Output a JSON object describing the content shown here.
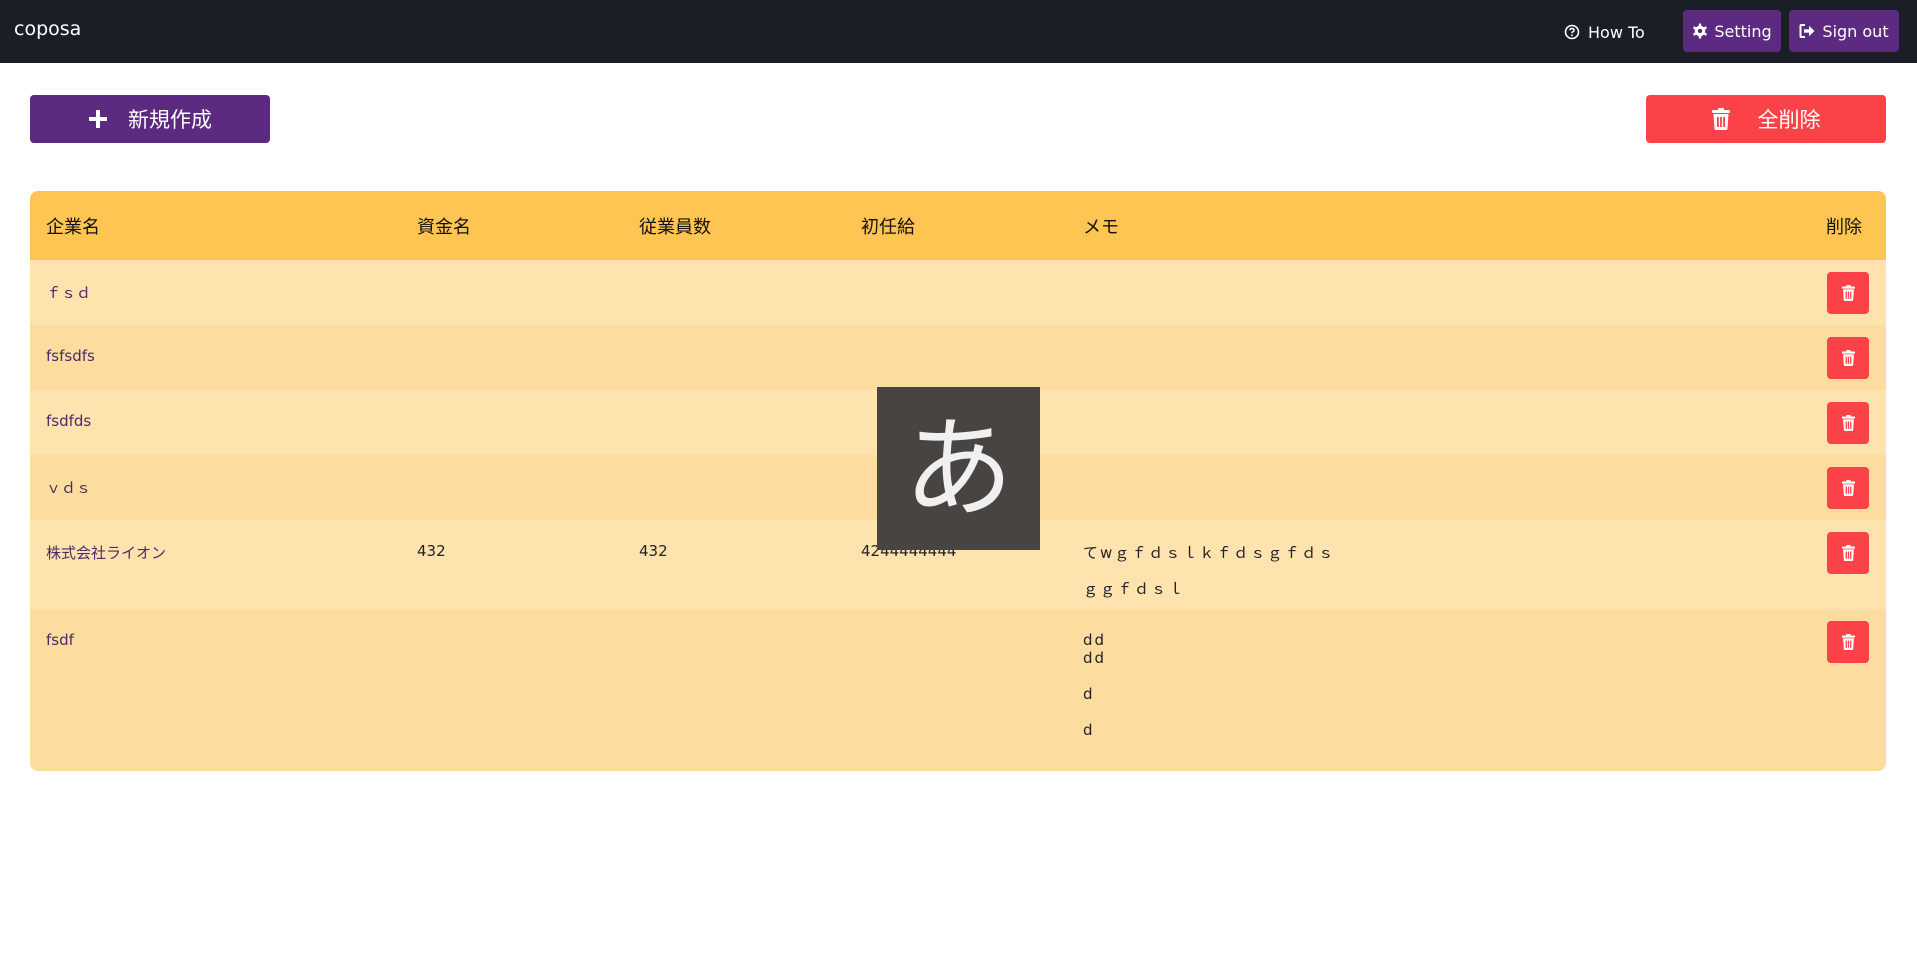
{
  "navbar": {
    "brand": "coposa",
    "howto_label": "How To",
    "setting_label": "Setting",
    "signout_label": "Sign out"
  },
  "actions": {
    "new_label": "新規作成",
    "delete_all_label": "全削除"
  },
  "table": {
    "headers": {
      "company": "企業名",
      "capital": "資金名",
      "employees": "従業員数",
      "salary": "初任給",
      "memo": "メモ",
      "delete": "削除"
    },
    "rows": [
      {
        "company": "ｆｓｄ",
        "capital": "",
        "employees": "",
        "salary": "",
        "memo": []
      },
      {
        "company": "fsfsdfs",
        "capital": "",
        "employees": "",
        "salary": "",
        "memo": []
      },
      {
        "company": "fsdfds",
        "capital": "",
        "employees": "",
        "salary": "",
        "memo": []
      },
      {
        "company": "ｖｄｓ",
        "capital": "",
        "employees": "",
        "salary": "",
        "memo": []
      },
      {
        "company": "株式会社ライオン",
        "capital": "432",
        "employees": "432",
        "salary": "4244444444",
        "memo": [
          "てwｇｆｄｓｌｋｆｄｓｇｆｄｓ",
          "ｇｇｆｄｓｌ"
        ]
      },
      {
        "company": "fsdf",
        "capital": "",
        "employees": "",
        "salary": "",
        "memo": [
          "dd",
          "dd",
          "",
          "d",
          "",
          "d"
        ]
      }
    ]
  },
  "ime_indicator": "あ",
  "colors": {
    "navbar": "#1b1e26",
    "primary": "#5c2a80",
    "danger": "#fb4248",
    "table_header": "#fec553",
    "row_odd": "#fee3ae",
    "row_even": "#fddd9f"
  }
}
